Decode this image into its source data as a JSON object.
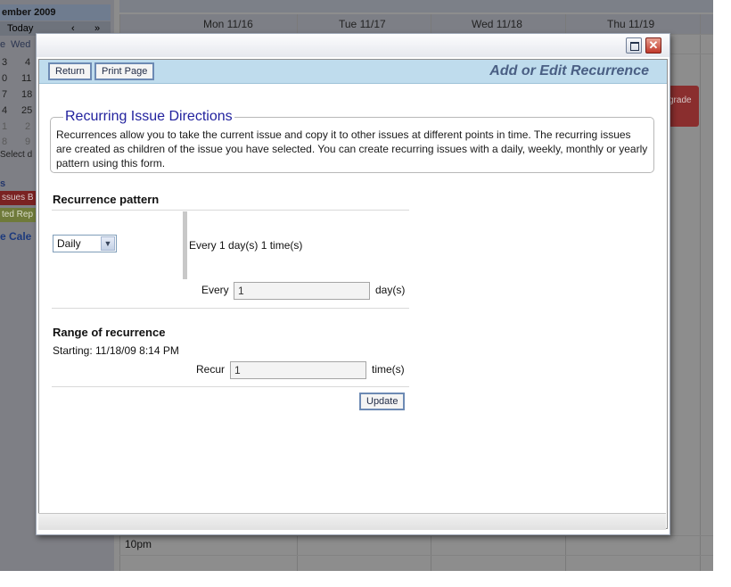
{
  "background": {
    "mini_month": "ember 2009",
    "today_label": "Today",
    "nav_prev": "‹",
    "nav_next": "»",
    "weekday_fragment": "e",
    "weekday_wed": "Wed",
    "mini_rows": [
      [
        "3",
        "4"
      ],
      [
        "0",
        "11"
      ],
      [
        "7",
        "18"
      ],
      [
        "4",
        "25"
      ],
      [
        "1",
        "2"
      ],
      [
        "8",
        "9"
      ]
    ],
    "select_date": "Select d",
    "issues_header": "s",
    "tag_issues": "ssues B",
    "tag_reports": "ted Rep",
    "calendar_link": "e Cale",
    "day_headers": [
      "Mon 11/16",
      "Tue 11/17",
      "Wed 11/18",
      "Thu 11/19"
    ],
    "upgrade_tag": "grade",
    "time_10pm": "10pm"
  },
  "window": {
    "maximize_icon": "maximize-icon",
    "close_icon": "close-icon",
    "close_glyph": "✕"
  },
  "toolbar": {
    "return_label": "Return",
    "print_label": "Print Page",
    "page_heading": "Add or Edit Recurrence"
  },
  "directions": {
    "title": "Recurring Issue Directions",
    "text": "Recurrences allow you to take the current issue and copy it to other issues at different points in time. The recurring issues are created as children of the issue you have selected. You can create recurring issues with a daily, weekly, monthly or yearly pattern using this form."
  },
  "pattern": {
    "title": "Recurrence pattern",
    "selected": "Daily",
    "summary": "Every 1 day(s) 1 time(s)",
    "every_label": "Every",
    "every_value": "1",
    "every_unit": "day(s)"
  },
  "range": {
    "title": "Range of recurrence",
    "starting": "Starting: 11/18/09 8:14 PM",
    "recur_label": "Recur",
    "recur_value": "1",
    "recur_unit": "time(s)"
  },
  "actions": {
    "update_label": "Update"
  }
}
